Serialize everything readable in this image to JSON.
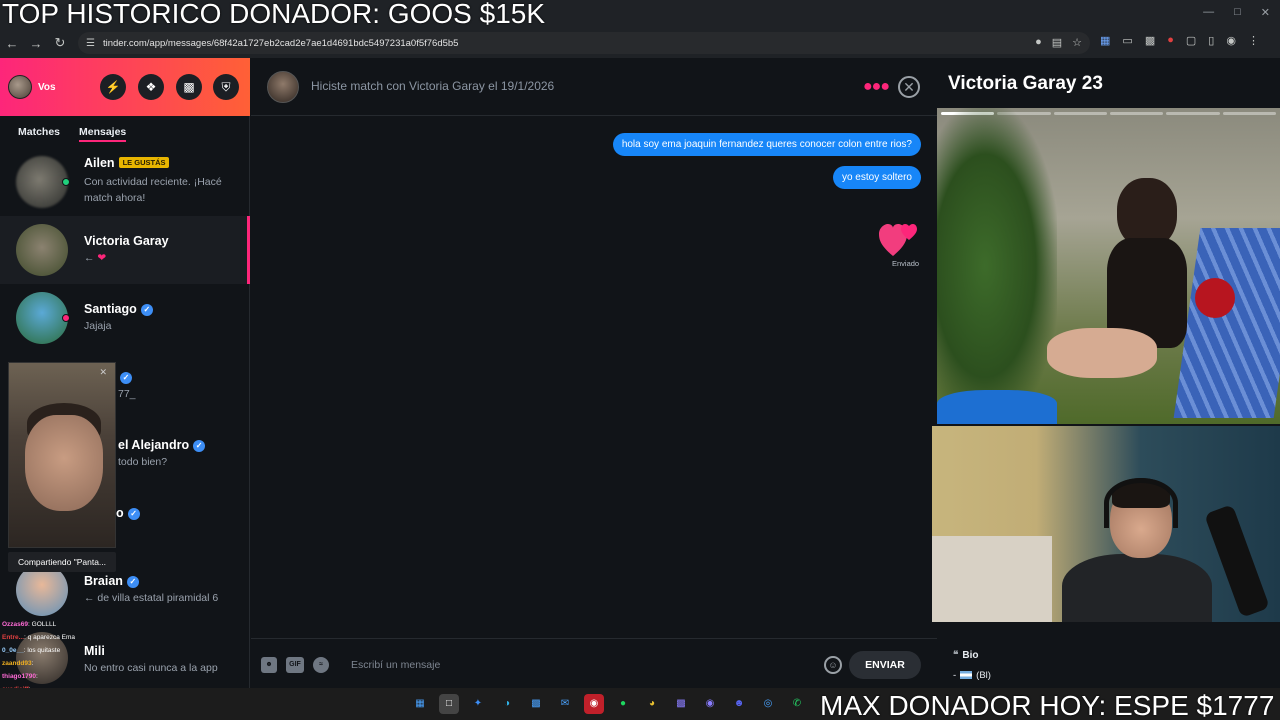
{
  "overlay": {
    "top_banner": "TOP HISTORICO DONADOR: GOOS $15K",
    "bottom_ticker": "MAX DONADOR HOY: ESPE $1777"
  },
  "browser": {
    "url": "tinder.com/app/messages/68f42a1727eb2cad2e7ae1d4691bdc5497231a0f5f76d5b5"
  },
  "sidebar": {
    "me_label": "Vos",
    "tabs": [
      {
        "label": "Matches"
      },
      {
        "label": "Mensajes"
      }
    ],
    "conversations": [
      {
        "name": "Ailen",
        "badge": "LE GUSTÁS",
        "preview": "Con actividad reciente. ¡Hacé match ahora!"
      },
      {
        "name": "Victoria Garay",
        "preview": "←"
      },
      {
        "name": "Santiago",
        "preview": "Jajaja"
      },
      {
        "name": "",
        "preview": "77_"
      },
      {
        "name": "el Alejandro",
        "preview": "todo bien?"
      },
      {
        "name": "o",
        "preview": ""
      },
      {
        "name": "Braian",
        "preview": "← de villa estatal piramidal 6"
      },
      {
        "name": "Mili",
        "preview": "No entro casi nunca a la app"
      }
    ],
    "share_label": "Compartiendo \"Panta..."
  },
  "stream_chat": [
    {
      "user": "Ozzas69",
      "text": ": GOLLLL",
      "color": "#ff6bd6"
    },
    {
      "user": "Entre...",
      "text": ": q aparezca Ema",
      "color": "#e04040"
    },
    {
      "user": "0_0e__",
      "text": ": los quitaste",
      "color": "#9ad0ff"
    },
    {
      "user": "zaandd93",
      "text": ": ",
      "color": "#f0b020"
    },
    {
      "user": "thiago1790",
      "text": ": ",
      "color": "#ff6bd6"
    },
    {
      "user": "cuadiciff",
      "text": ": ",
      "color": "#e04040"
    },
    {
      "user": "thiago1790",
      "text": ": emoaa",
      "color": "#ff6bd6"
    }
  ],
  "chat": {
    "match_text": "Hiciste match con Victoria Garay el 19/1/2026",
    "messages": [
      {
        "text": "hola soy ema joaquin fernandez queres conocer colon entre rios?"
      },
      {
        "text": "yo estoy soltero"
      }
    ],
    "sent_label": "Enviado",
    "composer_placeholder": "Escribí un mensaje",
    "gif_label": "GIF",
    "send_label": "ENVIAR"
  },
  "profile": {
    "name_age": "Victoria Garay 23",
    "bio_label": "Bio",
    "bio_text": "(Bl)"
  },
  "colors": {
    "brand_gradient_start": "#fd267a",
    "brand_gradient_end": "#ff6036",
    "bubble_blue": "#1786f8"
  }
}
